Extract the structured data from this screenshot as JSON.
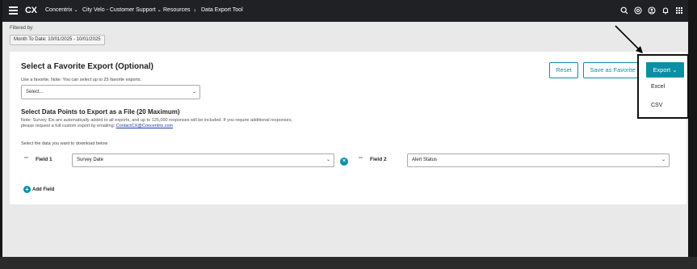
{
  "topbar": {
    "logo": "CX",
    "nav": [
      {
        "label": "Concentrix",
        "caret": "⌄"
      },
      {
        "label": "City Velo - Customer Support",
        "caret": "⌄"
      }
    ],
    "breadcrumb": [
      {
        "label": "Resources"
      },
      {
        "label": "Data Export Tool"
      }
    ],
    "breadcrumb_sep": "›"
  },
  "filter": {
    "label": "Filtered by:",
    "chip": "Month To Date: 10/01/2025 - 10/01/2025"
  },
  "favorite": {
    "title": "Select a Favorite Export (Optional)",
    "hint": "Use a favorite. Note: You can select up to 25 favorite exports.",
    "select_value": "Select..."
  },
  "datapoints": {
    "title": "Select Data Points to Export as a File (20 Maximum)",
    "note_line1": "Note: Survey IDs are automatically added to all exports, and up to 125,000 responses will be included. If you require additional responses,",
    "note_line2_prefix": "please request a full custom export by emailing: ",
    "note_email": "ContactCX@Concentrix.com",
    "select_hint": "Select the data you want to download below",
    "fields": [
      {
        "label": "Field 1",
        "value": "Survey Date"
      },
      {
        "label": "Field 2",
        "value": "Alert Status"
      }
    ],
    "add_field_label": "Add Field"
  },
  "actions": {
    "reset_label": "Reset",
    "save_favorite_label": "Save as Favorite",
    "export_label": "Export",
    "export_caret": "⌄",
    "export_menu": [
      {
        "label": "Excel"
      },
      {
        "label": "CSV"
      }
    ]
  },
  "icons": {
    "accent": "#0c8fa6",
    "top_icons": [
      "search-icon",
      "help-icon",
      "user-icon",
      "bell-icon",
      "grid-icon"
    ]
  }
}
